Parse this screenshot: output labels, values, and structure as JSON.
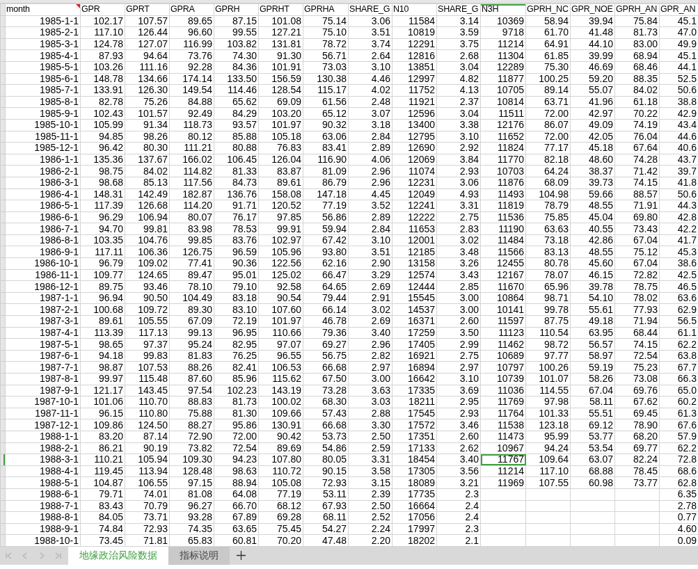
{
  "sheet": {
    "columns": [
      {
        "label": "month",
        "selected": false,
        "comment": true
      },
      {
        "label": "GPR",
        "selected": false,
        "comment": false
      },
      {
        "label": "GPRT",
        "selected": false,
        "comment": false
      },
      {
        "label": "GPRA",
        "selected": false,
        "comment": false
      },
      {
        "label": "GPRH",
        "selected": false,
        "comment": false
      },
      {
        "label": "GPRHT",
        "selected": false,
        "comment": false
      },
      {
        "label": "GPRHA",
        "selected": false,
        "comment": false
      },
      {
        "label": "SHARE_G",
        "selected": false,
        "comment": false
      },
      {
        "label": "N10",
        "selected": false,
        "comment": false
      },
      {
        "label": "SHARE_G",
        "selected": false,
        "comment": false
      },
      {
        "label": "N3H",
        "selected": true,
        "comment": false
      },
      {
        "label": "GPRH_NC",
        "selected": false,
        "comment": false
      },
      {
        "label": "GPR_NOE",
        "selected": false,
        "comment": false
      },
      {
        "label": "GPRH_AN",
        "selected": false,
        "comment": false
      },
      {
        "label": "GPR_AN",
        "selected": false,
        "comment": false
      }
    ],
    "rows": [
      {
        "selected": false,
        "cells": [
          "1985-1-1",
          "102.17",
          "107.57",
          "89.65",
          "87.15",
          "101.08",
          "75.14",
          "3.06",
          "11584",
          "3.14",
          "10369",
          "58.94",
          "39.94",
          "75.84",
          "45.1"
        ]
      },
      {
        "selected": false,
        "cells": [
          "1985-2-1",
          "117.10",
          "126.44",
          "96.60",
          "99.55",
          "127.21",
          "75.10",
          "3.51",
          "10819",
          "3.59",
          "9718",
          "61.70",
          "41.48",
          "81.73",
          "47.0"
        ]
      },
      {
        "selected": false,
        "cells": [
          "1985-3-1",
          "124.78",
          "127.07",
          "116.99",
          "103.82",
          "131.81",
          "78.72",
          "3.74",
          "12291",
          "3.75",
          "11214",
          "64.91",
          "44.10",
          "83.00",
          "49.9"
        ]
      },
      {
        "selected": false,
        "cells": [
          "1985-4-1",
          "87.93",
          "94.64",
          "73.76",
          "74.30",
          "91.30",
          "56.71",
          "2.64",
          "12816",
          "2.68",
          "11304",
          "61.85",
          "39.99",
          "68.94",
          "45.1"
        ]
      },
      {
        "selected": false,
        "cells": [
          "1985-5-1",
          "103.26",
          "111.16",
          "92.28",
          "84.36",
          "101.91",
          "73.03",
          "3.10",
          "13851",
          "3.04",
          "12289",
          "75.30",
          "46.69",
          "68.46",
          "44.1"
        ]
      },
      {
        "selected": false,
        "cells": [
          "1985-6-1",
          "148.78",
          "134.66",
          "174.14",
          "133.50",
          "156.59",
          "130.38",
          "4.46",
          "12997",
          "4.82",
          "11877",
          "100.25",
          "59.20",
          "88.35",
          "52.5"
        ]
      },
      {
        "selected": false,
        "cells": [
          "1985-7-1",
          "133.91",
          "126.30",
          "149.54",
          "114.46",
          "128.54",
          "115.17",
          "4.02",
          "11752",
          "4.13",
          "10705",
          "89.14",
          "55.07",
          "84.02",
          "50.6"
        ]
      },
      {
        "selected": false,
        "cells": [
          "1985-8-1",
          "82.78",
          "75.26",
          "84.88",
          "65.62",
          "69.09",
          "61.56",
          "2.48",
          "11921",
          "2.37",
          "10814",
          "63.71",
          "41.96",
          "61.18",
          "38.8"
        ]
      },
      {
        "selected": false,
        "cells": [
          "1985-9-1",
          "102.43",
          "101.57",
          "92.49",
          "84.29",
          "103.20",
          "65.12",
          "3.07",
          "12596",
          "3.04",
          "11511",
          "72.00",
          "42.97",
          "70.22",
          "42.9"
        ]
      },
      {
        "selected": false,
        "cells": [
          "1985-10-1",
          "105.99",
          "91.34",
          "118.73",
          "93.57",
          "101.97",
          "90.32",
          "3.18",
          "13400",
          "3.38",
          "12176",
          "86.07",
          "49.09",
          "74.19",
          "43.4"
        ]
      },
      {
        "selected": false,
        "cells": [
          "1985-11-1",
          "94.85",
          "98.26",
          "80.12",
          "85.88",
          "105.18",
          "63.06",
          "2.84",
          "12795",
          "3.10",
          "11652",
          "72.00",
          "42.05",
          "76.04",
          "44.6"
        ]
      },
      {
        "selected": false,
        "cells": [
          "1985-12-1",
          "96.42",
          "80.30",
          "111.21",
          "80.88",
          "76.83",
          "83.41",
          "2.89",
          "12690",
          "2.92",
          "11824",
          "77.17",
          "45.18",
          "67.64",
          "40.6"
        ]
      },
      {
        "selected": false,
        "cells": [
          "1986-1-1",
          "135.36",
          "137.67",
          "166.02",
          "106.45",
          "126.04",
          "116.90",
          "4.06",
          "12069",
          "3.84",
          "11770",
          "82.18",
          "48.60",
          "74.28",
          "43.7"
        ]
      },
      {
        "selected": false,
        "cells": [
          "1986-2-1",
          "98.75",
          "84.02",
          "114.82",
          "81.33",
          "83.87",
          "81.09",
          "2.96",
          "11074",
          "2.93",
          "10703",
          "64.24",
          "38.37",
          "71.42",
          "39.7"
        ]
      },
      {
        "selected": false,
        "cells": [
          "1986-3-1",
          "98.68",
          "85.13",
          "117.56",
          "84.73",
          "89.61",
          "86.79",
          "2.96",
          "12231",
          "3.06",
          "11876",
          "68.09",
          "39.73",
          "74.15",
          "41.8"
        ]
      },
      {
        "selected": false,
        "cells": [
          "1986-4-1",
          "148.31",
          "142.49",
          "182.87",
          "136.76",
          "158.08",
          "147.18",
          "4.45",
          "12049",
          "4.93",
          "11493",
          "104.98",
          "59.66",
          "88.57",
          "50.6"
        ]
      },
      {
        "selected": false,
        "cells": [
          "1986-5-1",
          "117.39",
          "126.68",
          "114.20",
          "91.71",
          "120.52",
          "77.19",
          "3.52",
          "12241",
          "3.31",
          "11819",
          "78.79",
          "48.55",
          "71.91",
          "44.3"
        ]
      },
      {
        "selected": false,
        "cells": [
          "1986-6-1",
          "96.29",
          "106.94",
          "80.07",
          "76.17",
          "97.85",
          "56.86",
          "2.89",
          "12222",
          "2.75",
          "11536",
          "75.85",
          "45.04",
          "69.80",
          "42.8"
        ]
      },
      {
        "selected": false,
        "cells": [
          "1986-7-1",
          "94.70",
          "99.81",
          "83.98",
          "78.53",
          "99.91",
          "59.94",
          "2.84",
          "11653",
          "2.83",
          "11190",
          "63.63",
          "40.55",
          "73.43",
          "42.2"
        ]
      },
      {
        "selected": false,
        "cells": [
          "1986-8-1",
          "103.35",
          "104.76",
          "99.85",
          "83.76",
          "102.97",
          "67.42",
          "3.10",
          "12001",
          "3.02",
          "11484",
          "73.18",
          "42.86",
          "67.04",
          "41.7"
        ]
      },
      {
        "selected": false,
        "cells": [
          "1986-9-1",
          "117.11",
          "106.36",
          "126.75",
          "96.59",
          "105.96",
          "93.80",
          "3.51",
          "12185",
          "3.48",
          "11566",
          "83.13",
          "48.55",
          "75.12",
          "45.3"
        ]
      },
      {
        "selected": false,
        "cells": [
          "1986-10-1",
          "96.79",
          "109.02",
          "77.41",
          "90.36",
          "122.56",
          "62.16",
          "2.90",
          "13158",
          "3.26",
          "12455",
          "80.78",
          "45.60",
          "67.04",
          "38.6"
        ]
      },
      {
        "selected": false,
        "cells": [
          "1986-11-1",
          "109.77",
          "124.65",
          "89.47",
          "95.01",
          "125.02",
          "66.47",
          "3.29",
          "12574",
          "3.43",
          "12167",
          "78.07",
          "46.15",
          "72.82",
          "42.5"
        ]
      },
      {
        "selected": false,
        "cells": [
          "1986-12-1",
          "89.75",
          "93.46",
          "78.10",
          "79.10",
          "92.58",
          "64.65",
          "2.69",
          "12444",
          "2.85",
          "11670",
          "65.96",
          "39.78",
          "78.75",
          "46.5"
        ]
      },
      {
        "selected": false,
        "cells": [
          "1987-1-1",
          "96.94",
          "90.50",
          "104.49",
          "83.18",
          "90.54",
          "79.44",
          "2.91",
          "15545",
          "3.00",
          "10864",
          "98.71",
          "54.10",
          "78.02",
          "63.6"
        ]
      },
      {
        "selected": false,
        "cells": [
          "1987-2-1",
          "100.68",
          "109.72",
          "89.30",
          "83.10",
          "107.60",
          "66.14",
          "3.02",
          "14537",
          "3.00",
          "10141",
          "99.78",
          "55.61",
          "77.93",
          "62.9"
        ]
      },
      {
        "selected": false,
        "cells": [
          "1987-3-1",
          "89.61",
          "105.55",
          "67.09",
          "72.19",
          "101.97",
          "46.78",
          "2.69",
          "16371",
          "2.60",
          "11597",
          "87.75",
          "49.18",
          "71.94",
          "56.5"
        ]
      },
      {
        "selected": false,
        "cells": [
          "1987-4-1",
          "113.39",
          "117.13",
          "99.13",
          "96.95",
          "110.66",
          "79.36",
          "3.40",
          "17259",
          "3.50",
          "11123",
          "110.54",
          "63.95",
          "68.44",
          "61.1"
        ]
      },
      {
        "selected": false,
        "cells": [
          "1987-5-1",
          "98.65",
          "97.37",
          "95.24",
          "82.95",
          "97.07",
          "69.27",
          "2.96",
          "17405",
          "2.99",
          "11462",
          "98.72",
          "56.57",
          "74.15",
          "62.2"
        ]
      },
      {
        "selected": false,
        "cells": [
          "1987-6-1",
          "94.18",
          "99.83",
          "81.83",
          "76.25",
          "96.55",
          "56.75",
          "2.82",
          "16921",
          "2.75",
          "10689",
          "97.77",
          "58.97",
          "72.54",
          "63.8"
        ]
      },
      {
        "selected": false,
        "cells": [
          "1987-7-1",
          "98.87",
          "107.53",
          "88.26",
          "82.41",
          "106.53",
          "66.68",
          "2.97",
          "16894",
          "2.97",
          "10797",
          "100.26",
          "59.19",
          "75.23",
          "67.7"
        ]
      },
      {
        "selected": false,
        "cells": [
          "1987-8-1",
          "99.97",
          "115.48",
          "87.60",
          "85.96",
          "115.62",
          "67.50",
          "3.00",
          "16642",
          "3.10",
          "10739",
          "101.07",
          "58.26",
          "73.08",
          "66.3"
        ]
      },
      {
        "selected": false,
        "cells": [
          "1987-9-1",
          "121.17",
          "143.45",
          "97.54",
          "102.23",
          "143.19",
          "73.28",
          "3.63",
          "17335",
          "3.69",
          "11036",
          "114.55",
          "67.04",
          "69.76",
          "65.0"
        ]
      },
      {
        "selected": false,
        "cells": [
          "1987-10-1",
          "101.06",
          "110.70",
          "88.83",
          "81.73",
          "100.02",
          "68.30",
          "3.03",
          "18211",
          "2.95",
          "11769",
          "97.98",
          "58.11",
          "67.62",
          "60.2"
        ]
      },
      {
        "selected": false,
        "cells": [
          "1987-11-1",
          "96.15",
          "110.80",
          "75.88",
          "81.30",
          "109.66",
          "57.43",
          "2.88",
          "17545",
          "2.93",
          "11764",
          "101.33",
          "55.51",
          "69.45",
          "61.3"
        ]
      },
      {
        "selected": false,
        "cells": [
          "1987-12-1",
          "109.86",
          "124.50",
          "88.27",
          "95.86",
          "130.91",
          "66.68",
          "3.30",
          "17572",
          "3.46",
          "11538",
          "123.18",
          "69.12",
          "78.90",
          "67.6"
        ]
      },
      {
        "selected": false,
        "cells": [
          "1988-1-1",
          "83.20",
          "87.14",
          "72.90",
          "72.00",
          "90.42",
          "53.73",
          "2.50",
          "17351",
          "2.60",
          "11473",
          "95.99",
          "53.77",
          "68.20",
          "57.9"
        ]
      },
      {
        "selected": false,
        "cells": [
          "1988-2-1",
          "86.21",
          "90.19",
          "73.82",
          "72.54",
          "89.69",
          "54.86",
          "2.59",
          "17133",
          "2.62",
          "10967",
          "94.24",
          "53.54",
          "69.77",
          "62.2"
        ]
      },
      {
        "selected": true,
        "cells": [
          "1988-3-1",
          "110.21",
          "105.94",
          "109.30",
          "94.23",
          "107.80",
          "80.05",
          "3.31",
          "18454",
          "3.40",
          "11767",
          "109.64",
          "63.07",
          "82.24",
          "72.8"
        ]
      },
      {
        "selected": false,
        "cells": [
          "1988-4-1",
          "119.45",
          "113.94",
          "128.48",
          "98.63",
          "110.72",
          "90.15",
          "3.58",
          "17305",
          "3.56",
          "11214",
          "117.10",
          "68.88",
          "78.45",
          "68.6"
        ]
      },
      {
        "selected": false,
        "cells": [
          "1988-5-1",
          "104.87",
          "106.55",
          "97.15",
          "88.94",
          "105.08",
          "72.93",
          "3.15",
          "18089",
          "3.21",
          "11969",
          "107.55",
          "60.98",
          "73.77",
          "62.8"
        ]
      },
      {
        "selected": false,
        "cells": [
          "1988-6-1",
          "79.71",
          "74.01",
          "81.08",
          "64.08",
          "77.19",
          "53.11",
          "2.39",
          "17735",
          "2.3",
          null,
          null,
          null,
          null,
          "6.35"
        ]
      },
      {
        "selected": false,
        "cells": [
          "1988-7-1",
          "83.43",
          "70.79",
          "96.27",
          "66.70",
          "68.12",
          "67.93",
          "2.50",
          "16664",
          "2.4",
          null,
          null,
          null,
          null,
          "2.78"
        ]
      },
      {
        "selected": false,
        "cells": [
          "1988-8-1",
          "84.05",
          "73.71",
          "93.28",
          "67.89",
          "69.28",
          "68.11",
          "2.52",
          "17056",
          "2.4",
          null,
          null,
          null,
          null,
          "0.77"
        ]
      },
      {
        "selected": false,
        "cells": [
          "1988-9-1",
          "74.84",
          "72.93",
          "74.35",
          "63.65",
          "75.45",
          "54.27",
          "2.24",
          "17997",
          "2.3",
          null,
          null,
          null,
          null,
          "4.60"
        ]
      },
      {
        "selected": false,
        "cells": [
          "1988-10-1",
          "73.45",
          "71.81",
          "65.83",
          "60.81",
          "70.20",
          "47.48",
          "2.20",
          "18202",
          "2.1",
          null,
          null,
          null,
          null,
          "0.09"
        ]
      }
    ]
  },
  "tabs": [
    {
      "label": "地缘政治风险数据",
      "selected": true
    },
    {
      "label": "指标说明",
      "selected": false
    }
  ]
}
